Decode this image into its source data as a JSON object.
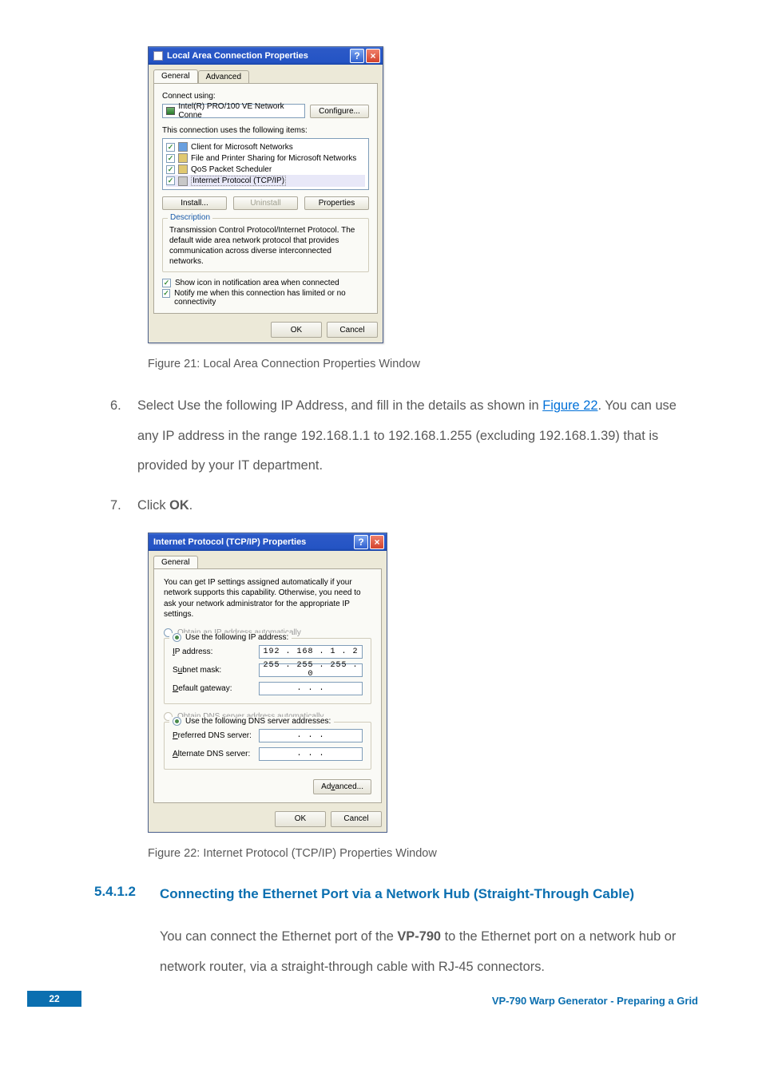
{
  "dialog1": {
    "title": "Local Area Connection Properties",
    "tabs": {
      "general": "General",
      "advanced": "Advanced"
    },
    "connect_using_label": "Connect using:",
    "nic": "Intel(R) PRO/100 VE Network Conne",
    "configure_btn": "Configure...",
    "items_label": "This connection uses the following items:",
    "items": [
      "Client for Microsoft Networks",
      "File and Printer Sharing for Microsoft Networks",
      "QoS Packet Scheduler",
      "Internet Protocol (TCP/IP)"
    ],
    "install_btn": "Install...",
    "uninstall_btn": "Uninstall",
    "properties_btn": "Properties",
    "description_label": "Description",
    "description_text": "Transmission Control Protocol/Internet Protocol. The default wide area network protocol that provides communication across diverse interconnected networks.",
    "chk_showicon": "Show icon in notification area when connected",
    "chk_notify": "Notify me when this connection has limited or no connectivity",
    "ok": "OK",
    "cancel": "Cancel"
  },
  "caption1": "Figure 21: Local Area Connection Properties Window",
  "step6_a": "Select Use the following IP Address, and fill in the details as shown in ",
  "step6_link": "Figure 22",
  "step6_b": ". You can use any IP address in the range 192.168.1.1 to 192.168.1.255 (excluding 192.168.1.39) that is provided by your IT department.",
  "step7_a": "Click ",
  "step7_b": "OK",
  "step7_c": ".",
  "dialog2": {
    "title": "Internet Protocol (TCP/IP) Properties",
    "tab_general": "General",
    "desc": "You can get IP settings assigned automatically if your network supports this capability. Otherwise, you need to ask your network administrator for the appropriate IP settings.",
    "radio_auto_ip": "Obtain an IP address automatically",
    "radio_use_ip": "Use the following IP address:",
    "ip_label": "IP address:",
    "ip_value": "192 . 168 .  1  .  2 ",
    "subnet_label": "Subnet mask:",
    "subnet_value": "255 . 255 . 255 .  0 ",
    "gateway_label": "Default gateway:",
    "gateway_value": "   .    .    .   ",
    "radio_auto_dns": "Obtain DNS server address automatically",
    "radio_use_dns": "Use the following DNS server addresses:",
    "pref_dns_label": "Preferred DNS server:",
    "pref_dns_value": "   .    .    .   ",
    "alt_dns_label": "Alternate DNS server:",
    "alt_dns_value": "   .    .    .   ",
    "advanced_btn": "Advanced...",
    "ok": "OK",
    "cancel": "Cancel"
  },
  "caption2": "Figure 22: Internet Protocol (TCP/IP) Properties Window",
  "section": {
    "num": "5.4.1.2",
    "title": "Connecting the Ethernet Port via a Network Hub (Straight-Through Cable)"
  },
  "body_a": "You can connect the Ethernet port of the ",
  "body_b": "VP-790",
  "body_c": " to the Ethernet port on a network hub or network router, via a straight-through cable with RJ-45 connectors.",
  "footer": {
    "page": "22",
    "doc": "VP-790 Warp Generator - Preparing a Grid"
  }
}
